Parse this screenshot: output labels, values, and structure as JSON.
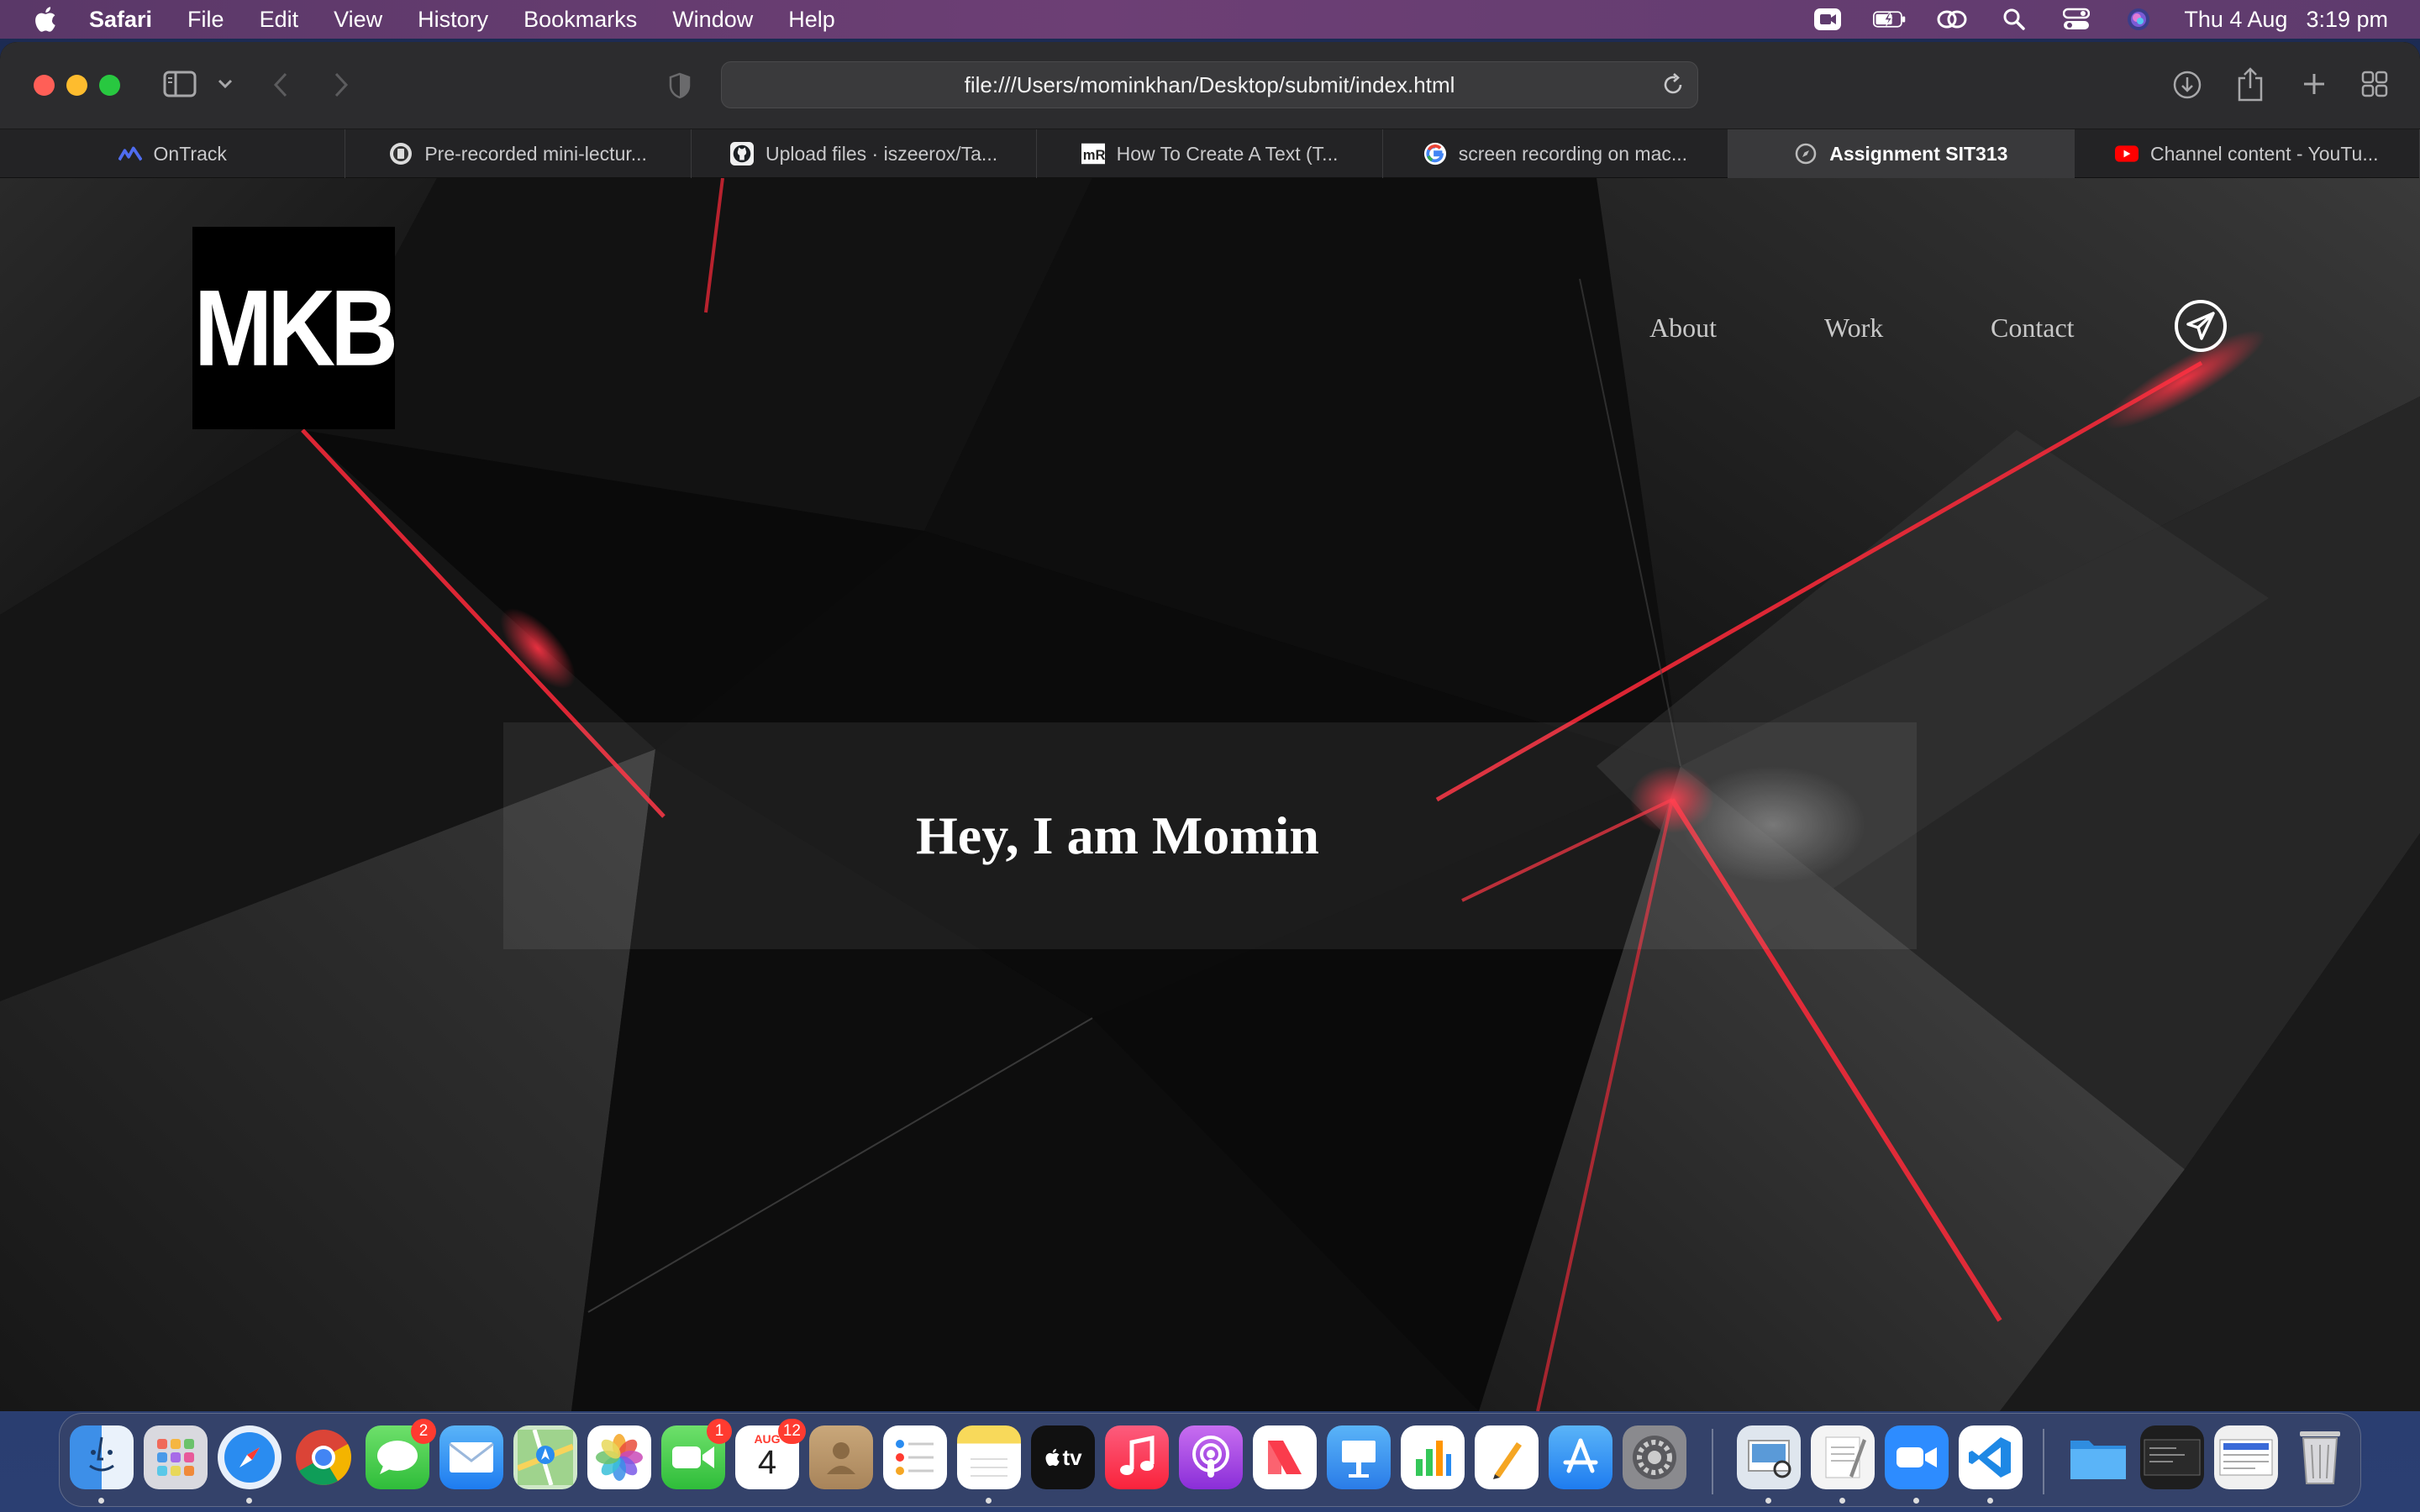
{
  "menubar": {
    "app_name": "Safari",
    "items": [
      "File",
      "Edit",
      "View",
      "History",
      "Bookmarks",
      "Window",
      "Help"
    ],
    "date": "Thu 4 Aug",
    "time": "3:19 pm"
  },
  "browser": {
    "url": "file:///Users/mominkhan/Desktop/submit/index.html",
    "tabs": [
      {
        "label": "OnTrack",
        "icon": "ontrack-icon"
      },
      {
        "label": "Pre-recorded mini-lectur...",
        "icon": "deakin-icon"
      },
      {
        "label": "Upload files · iszeerox/Ta...",
        "icon": "github-icon"
      },
      {
        "label": "How To Create A Text (T...",
        "icon": "mr-icon"
      },
      {
        "label": "screen recording on mac...",
        "icon": "google-icon"
      },
      {
        "label": "Assignment SIT313",
        "icon": "compass-icon",
        "active": true
      },
      {
        "label": "Channel content - YouTu...",
        "icon": "youtube-icon"
      }
    ]
  },
  "page": {
    "logo_text": "MKB",
    "nav": {
      "about": "About",
      "work": "Work",
      "contact": "Contact"
    },
    "hero_title": "Hey, I am Momin"
  },
  "dock": {
    "messages_badge": "2",
    "facetime_badge": "1",
    "calendar_month": "AUG",
    "calendar_day": "4",
    "calendar_badge": "12",
    "tv_label": "tv",
    "apps": [
      "finder",
      "launchpad",
      "safari",
      "chrome",
      "messages",
      "mail",
      "maps",
      "photos",
      "facetime",
      "calendar",
      "contacts",
      "reminders",
      "notes",
      "tv",
      "music",
      "podcasts",
      "news",
      "keynote",
      "numbers",
      "pages",
      "app-store",
      "system-preferences",
      "preview",
      "textedit",
      "zoom",
      "vscode",
      "folder",
      "screenshot",
      "documents",
      "trash"
    ]
  }
}
